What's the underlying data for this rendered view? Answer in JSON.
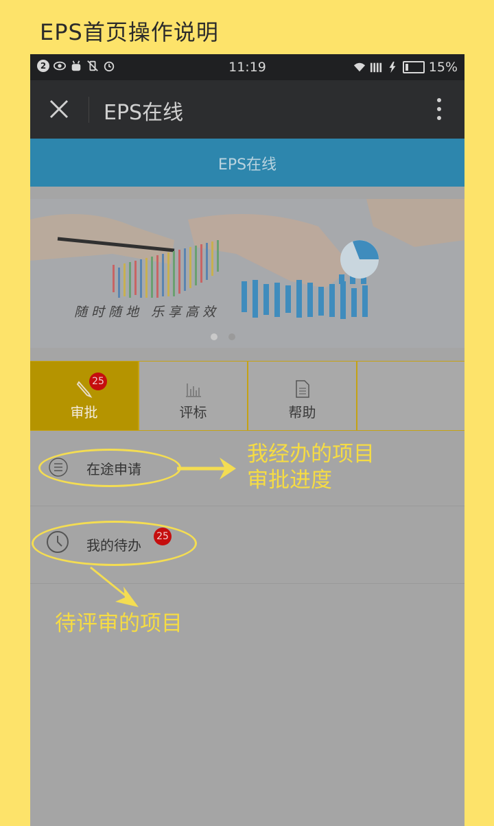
{
  "page_title": "EPS首页操作说明",
  "status_bar": {
    "notif_count": "2",
    "time": "11:19",
    "battery": "15%"
  },
  "app_bar": {
    "title": "EPS在线"
  },
  "header_bar": {
    "title": "EPS在线"
  },
  "banner": {
    "caption": "随时随地 乐享高效"
  },
  "tabs": [
    {
      "label": "审批",
      "badge": "25",
      "icon": "pencil-icon",
      "active": true
    },
    {
      "label": "评标",
      "icon": "bar-chart-icon",
      "active": false
    },
    {
      "label": "帮助",
      "icon": "document-icon",
      "active": false
    },
    {
      "label": "",
      "active": false
    }
  ],
  "list": [
    {
      "label": "在途申请",
      "icon": "list-icon"
    },
    {
      "label": "我的待办",
      "icon": "clock-icon",
      "badge": "25"
    }
  ],
  "annotations": {
    "in_progress_line1": "我经办的项目",
    "in_progress_line2": "审批进度",
    "todo": "待评审的项目"
  },
  "colors": {
    "background": "#fde36a",
    "annotation": "#f6dc43",
    "active_tab": "#b59400",
    "badge": "#c50e0e"
  }
}
